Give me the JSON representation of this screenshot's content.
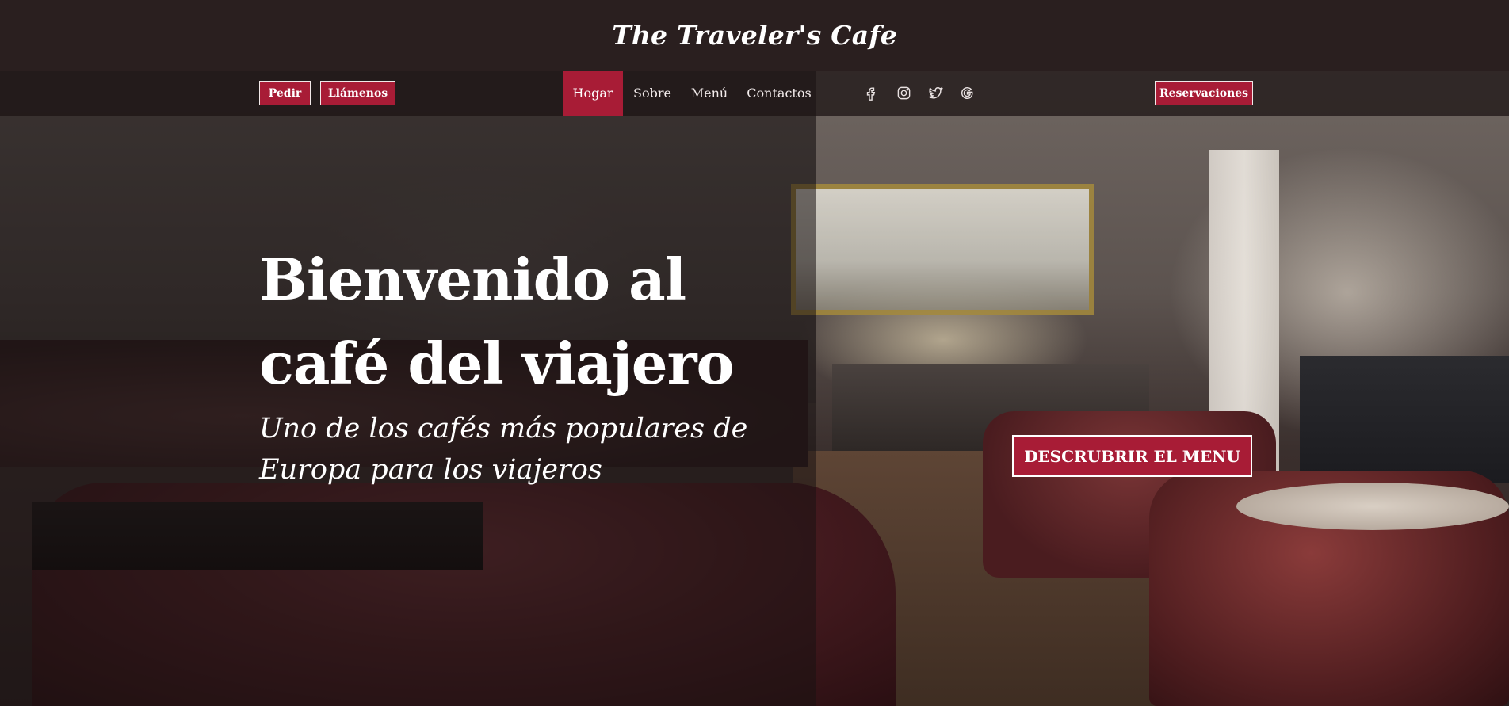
{
  "header": {
    "brand": "The Traveler's Cafe"
  },
  "nav": {
    "left_buttons": {
      "order": "Pedir",
      "call": "Llámenos"
    },
    "menu": [
      "Hogar",
      "Sobre",
      "Menú",
      "Contactos"
    ],
    "active": "Hogar",
    "social": [
      "facebook-icon",
      "instagram-icon",
      "twitter-icon",
      "google-icon"
    ],
    "reserve": "Reservaciones"
  },
  "hero": {
    "title_line1": "Bienvenido al",
    "title_line2": "café del viajero",
    "subtitle_line1": "Uno de los cafés más populares de",
    "subtitle_line2": "Europa para los viajeros",
    "cta": "DESCRUBRIR EL MENU"
  },
  "colors": {
    "accent": "#a81c36",
    "topbar": "#2a1f1f"
  }
}
